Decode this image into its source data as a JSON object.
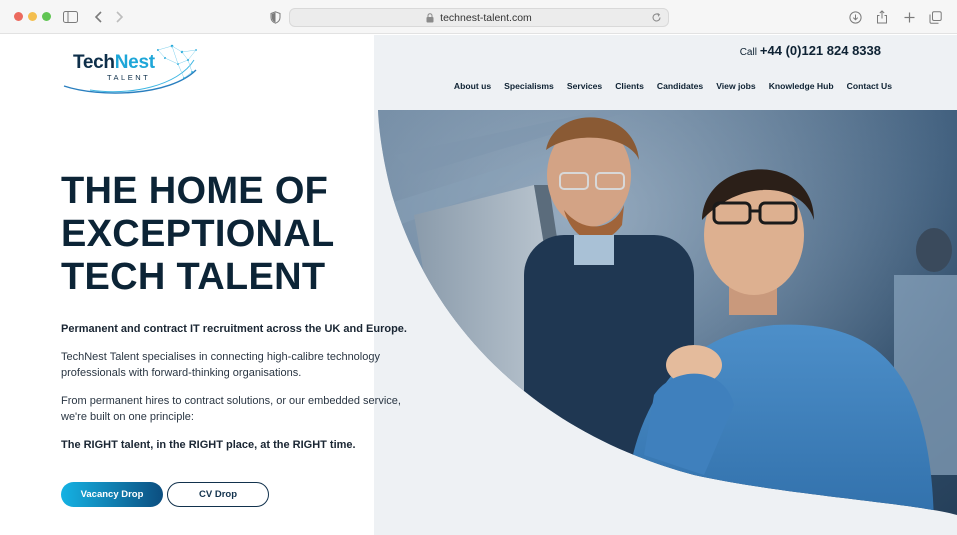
{
  "browser": {
    "url": "technest-talent.com"
  },
  "header": {
    "logo": {
      "part1": "Tech",
      "part2": "Nest",
      "sub": "TALENT"
    },
    "call_label": "Call",
    "phone": "+44 (0)121 824 8338",
    "nav": [
      "About us",
      "Specialisms",
      "Services",
      "Clients",
      "Candidates",
      "View jobs",
      "Knowledge Hub",
      "Contact Us"
    ]
  },
  "hero": {
    "headline": [
      "THE HOME OF",
      "EXCEPTIONAL",
      "TECH TALENT"
    ],
    "lead": "Permanent and contract IT recruitment across the UK and Europe.",
    "para1": "TechNest Talent specialises in connecting high-calibre technology professionals with forward-thinking organisations.",
    "para2": "From permanent hires to contract solutions, or our embedded service, we're built on one principle:",
    "principle": "The RIGHT talent, in the RIGHT place, at the RIGHT time.",
    "primary_button": "Vacancy Drop",
    "secondary_button": "CV Drop"
  },
  "colors": {
    "navy": "#0c2436",
    "accent": "#15b2e3",
    "accent_dark": "#0c4e80"
  }
}
